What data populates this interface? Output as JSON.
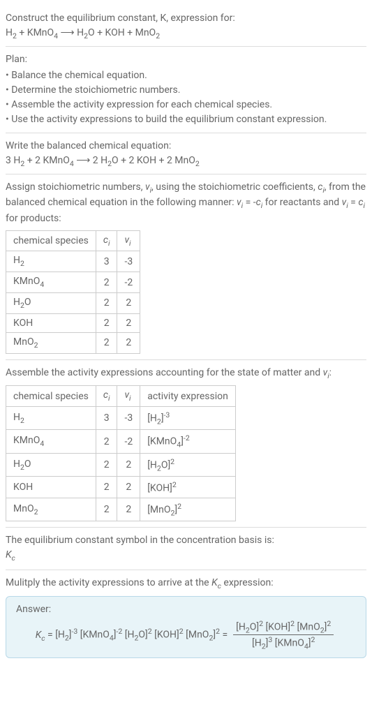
{
  "intro": {
    "line1": "Construct the equilibrium constant, K, expression for:",
    "equation": "H₂ + KMnO₄ ⟶ H₂O + KOH + MnO₂"
  },
  "plan": {
    "heading": "Plan:",
    "items": [
      "Balance the chemical equation.",
      "Determine the stoichiometric numbers.",
      "Assemble the activity expression for each chemical species.",
      "Use the activity expressions to build the equilibrium constant expression."
    ]
  },
  "balanced": {
    "heading": "Write the balanced chemical equation:",
    "equation": "3 H₂ + 2 KMnO₄ ⟶ 2 H₂O + 2 KOH + 2 MnO₂"
  },
  "stoich": {
    "text": "Assign stoichiometric numbers, νᵢ, using the stoichiometric coefficients, cᵢ, from the balanced chemical equation in the following manner: νᵢ = -cᵢ for reactants and νᵢ = cᵢ for products:",
    "headers": [
      "chemical species",
      "cᵢ",
      "νᵢ"
    ],
    "rows": [
      {
        "species": "H₂",
        "c": "3",
        "v": "-3"
      },
      {
        "species": "KMnO₄",
        "c": "2",
        "v": "-2"
      },
      {
        "species": "H₂O",
        "c": "2",
        "v": "2"
      },
      {
        "species": "KOH",
        "c": "2",
        "v": "2"
      },
      {
        "species": "MnO₂",
        "c": "2",
        "v": "2"
      }
    ]
  },
  "activity": {
    "text": "Assemble the activity expressions accounting for the state of matter and νᵢ:",
    "headers": [
      "chemical species",
      "cᵢ",
      "νᵢ",
      "activity expression"
    ],
    "rows": [
      {
        "species": "H₂",
        "c": "3",
        "v": "-3",
        "expr": "[H₂]⁻³"
      },
      {
        "species": "KMnO₄",
        "c": "2",
        "v": "-2",
        "expr": "[KMnO₄]⁻²"
      },
      {
        "species": "H₂O",
        "c": "2",
        "v": "2",
        "expr": "[H₂O]²"
      },
      {
        "species": "KOH",
        "c": "2",
        "v": "2",
        "expr": "[KOH]²"
      },
      {
        "species": "MnO₂",
        "c": "2",
        "v": "2",
        "expr": "[MnO₂]²"
      }
    ]
  },
  "symbol": {
    "line1": "The equilibrium constant symbol in the concentration basis is:",
    "line2": "K_c"
  },
  "multiply": {
    "text": "Mulitply the activity expressions to arrive at the K_c expression:"
  },
  "answer": {
    "label": "Answer:",
    "lhs": "K_c = [H₂]⁻³ [KMnO₄]⁻² [H₂O]² [KOH]² [MnO₂]² =",
    "numerator": "[H₂O]² [KOH]² [MnO₂]²",
    "denominator": "[H₂]³ [KMnO₄]²"
  },
  "chart_data": {
    "type": "table",
    "tables": [
      {
        "title": "Stoichiometric numbers",
        "columns": [
          "chemical species",
          "c_i",
          "ν_i"
        ],
        "rows": [
          [
            "H2",
            3,
            -3
          ],
          [
            "KMnO4",
            2,
            -2
          ],
          [
            "H2O",
            2,
            2
          ],
          [
            "KOH",
            2,
            2
          ],
          [
            "MnO2",
            2,
            2
          ]
        ]
      },
      {
        "title": "Activity expressions",
        "columns": [
          "chemical species",
          "c_i",
          "ν_i",
          "activity expression"
        ],
        "rows": [
          [
            "H2",
            3,
            -3,
            "[H2]^-3"
          ],
          [
            "KMnO4",
            2,
            -2,
            "[KMnO4]^-2"
          ],
          [
            "H2O",
            2,
            2,
            "[H2O]^2"
          ],
          [
            "KOH",
            2,
            2,
            "[KOH]^2"
          ],
          [
            "MnO2",
            2,
            2,
            "[MnO2]^2"
          ]
        ]
      }
    ]
  }
}
